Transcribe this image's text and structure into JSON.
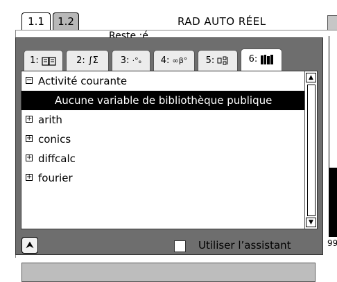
{
  "document": {
    "tabs": [
      "1.1",
      "1.2"
    ],
    "status": "RAD AUTO RÉEL",
    "background_text": "Reste :é",
    "background_number": "99"
  },
  "catalog": {
    "tabs": [
      {
        "num": "1:",
        "icon": "book-icon"
      },
      {
        "num": "2:",
        "icon": "integral-sum-icon"
      },
      {
        "num": "3:",
        "icon": "units-icon"
      },
      {
        "num": "4:",
        "icon": "symbols-icon"
      },
      {
        "num": "5:",
        "icon": "templates-icon"
      },
      {
        "num": "6:",
        "icon": "library-icon"
      }
    ],
    "active_tab": 5,
    "items": [
      {
        "label": "Activité courante",
        "box": "−"
      },
      {
        "label": "Aucune variable de bibliothèque publique",
        "selected": true
      },
      {
        "label": "arith",
        "box": "+"
      },
      {
        "label": "conics",
        "box": "+"
      },
      {
        "label": "diffcalc",
        "box": "+"
      },
      {
        "label": "fourier",
        "box": "+"
      }
    ],
    "wizard_label": "Utiliser l’assistant",
    "wizard_checked": false
  }
}
